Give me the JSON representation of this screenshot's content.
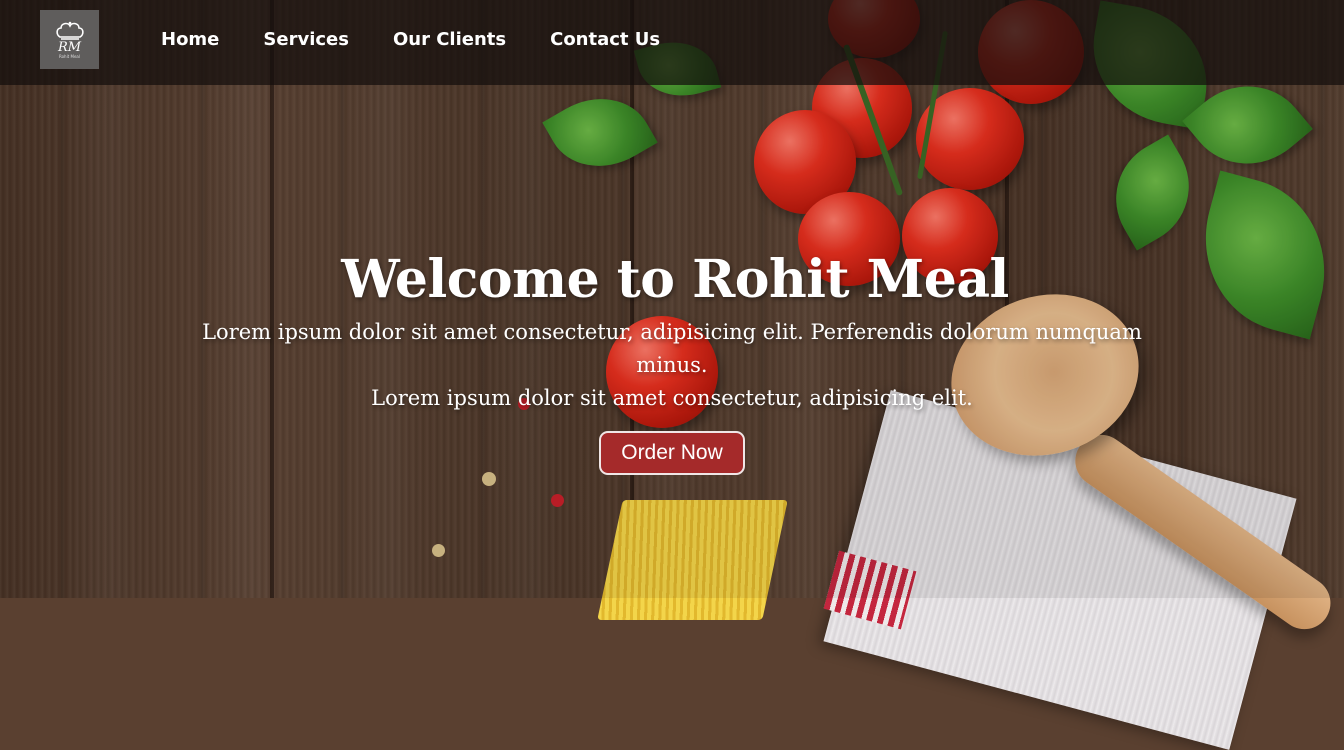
{
  "logo": {
    "initials": "RM",
    "tagline": "Rohit Meal"
  },
  "nav": {
    "items": [
      {
        "label": "Home"
      },
      {
        "label": "Services"
      },
      {
        "label": "Our Clients"
      },
      {
        "label": "Contact Us"
      }
    ]
  },
  "hero": {
    "title": "Welcome to Rohit Meal",
    "line1": "Lorem ipsum dolor sit amet consectetur, adipisicing elit. Perferendis dolorum numquam minus.",
    "line2": "Lorem ipsum dolor sit amet consectetur, adipisicing elit.",
    "button_label": "Order Now"
  },
  "colors": {
    "button_bg": "#a52a2a",
    "navbar_bg": "rgba(20,14,12,0.72)",
    "text": "#ffffff"
  }
}
